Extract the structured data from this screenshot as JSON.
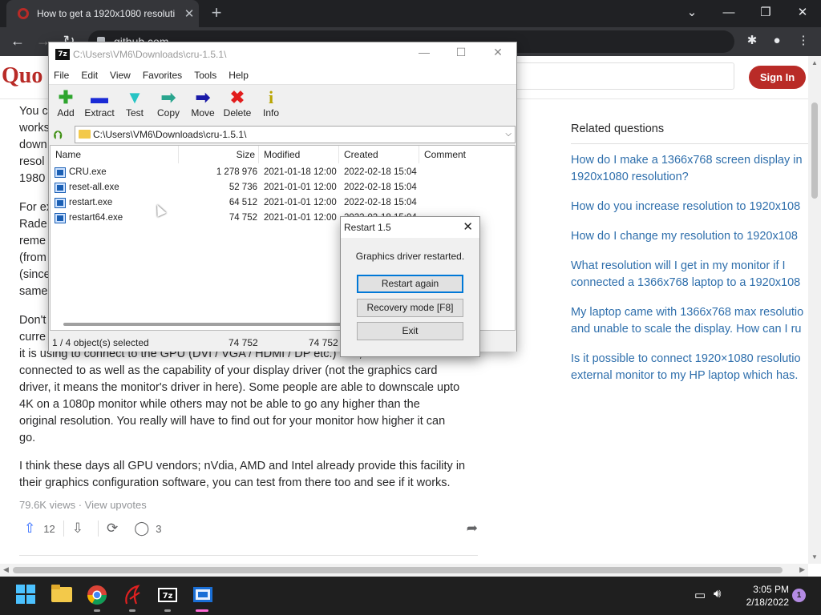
{
  "browser": {
    "tab_title": "How to get a 1920x1080 resoluti",
    "tab_close": "✕",
    "new_tab": "+",
    "address": "github.com"
  },
  "quora": {
    "logo": "Quo",
    "sign_in": "Sign In",
    "paragraphs": [
      [
        "You c",
        "works",
        "down",
        "resol",
        "1980"
      ],
      [
        "For ex",
        "Rade",
        "reme",
        "(from",
        "(since",
        "same"
      ],
      [
        "Don't",
        "curre"
      ]
    ],
    "body_lines": [
      "it is using to connect to the GPU (DVI / VGA / HDMI / DP etc.) and, the OS it's",
      "connected to as well as the capability of your display driver (not the graphics card",
      "driver, it means the monitor's driver in here). Some people are able to downscale upto",
      "4K on a 1080p monitor while others may not be able to go any higher than the",
      "original resolution. You really will have to find out for your monitor how higher it can",
      "go."
    ],
    "closing_lines": [
      "I think these days all GPU vendors; nVdia, AMD and Intel already provide this facility in",
      "their graphics configuration software, you can test from there too and see if it works."
    ],
    "views": "79.6K views · View upvotes",
    "upvotes": "12",
    "comments": "3",
    "related_heading": "Related questions",
    "related": [
      [
        "How do I make a 1366x768 screen display in",
        "1920x1080 resolution?"
      ],
      [
        "How do you increase resolution to 1920x108"
      ],
      [
        "How do I change my resolution to 1920x108"
      ],
      [
        "What resolution will I get in my monitor if I",
        "connected a 1366x768 laptop to a 1920x108"
      ],
      [
        "My laptop came with 1366x768 max resolutio",
        "and unable to scale the display. How can I ru"
      ],
      [
        "Is it possible to connect 1920×1080 resolutio",
        "external monitor to my HP laptop which has."
      ]
    ]
  },
  "sevenzip": {
    "title": "C:\\Users\\VM6\\Downloads\\cru-1.5.1\\",
    "menu": [
      "File",
      "Edit",
      "View",
      "Favorites",
      "Tools",
      "Help"
    ],
    "tools": [
      {
        "label": "Add",
        "glyph": "✚",
        "color": "#2ea52e"
      },
      {
        "label": "Extract",
        "glyph": "▬",
        "color": "#1b2bd6"
      },
      {
        "label": "Test",
        "glyph": "▼",
        "color": "#27c4c4"
      },
      {
        "label": "Copy",
        "glyph": "➡",
        "color": "#2aa58e"
      },
      {
        "label": "Move",
        "glyph": "➡",
        "color": "#1a1aa8"
      },
      {
        "label": "Delete",
        "glyph": "✖",
        "color": "#e21d1d"
      },
      {
        "label": "Info",
        "glyph": "i",
        "color": "#b8a400"
      }
    ],
    "address": "C:\\Users\\VM6\\Downloads\\cru-1.5.1\\",
    "columns": [
      "Name",
      "Size",
      "Modified",
      "Created",
      "Comment"
    ],
    "files": [
      {
        "name": "CRU.exe",
        "size": "1 278 976",
        "modified": "2021-01-18 12:00",
        "created": "2022-02-18 15:04"
      },
      {
        "name": "reset-all.exe",
        "size": "52 736",
        "modified": "2021-01-01 12:00",
        "created": "2022-02-18 15:04"
      },
      {
        "name": "restart.exe",
        "size": "64 512",
        "modified": "2021-01-01 12:00",
        "created": "2022-02-18 15:04"
      },
      {
        "name": "restart64.exe",
        "size": "74 752",
        "modified": "2021-01-01 12:00",
        "created": "2022-02-18 15:04"
      }
    ],
    "status_selected": "1 / 4 object(s) selected",
    "status_size": "74 752",
    "status_size2": "74 752"
  },
  "dialog": {
    "title": "Restart 1.5",
    "message": "Graphics driver restarted.",
    "btn_restart": "Restart again",
    "btn_recovery": "Recovery mode [F8]",
    "btn_exit": "Exit"
  },
  "taskbar": {
    "time": "3:05 PM",
    "date": "2/18/2022",
    "notifications": "1"
  }
}
